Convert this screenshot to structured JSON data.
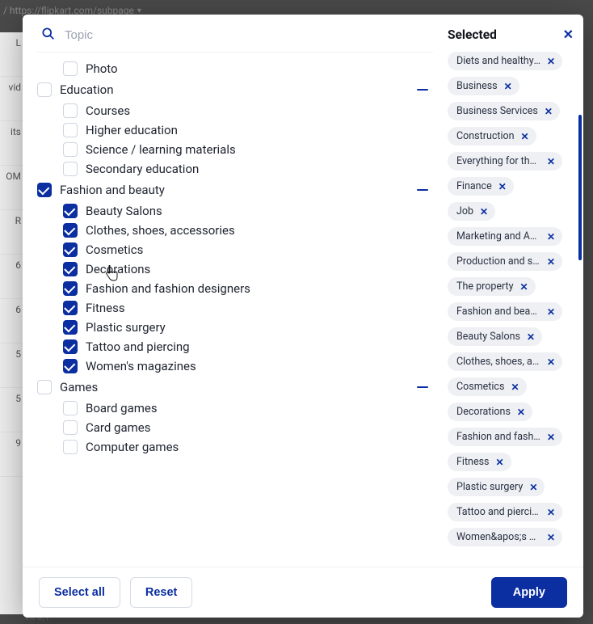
{
  "bg": {
    "url": "/ https://flipkart.com/subpage",
    "left_labels": [
      "L",
      "vid",
      "its",
      "OM",
      "R",
      "6",
      "6",
      "5",
      "5",
      "9"
    ],
    "bottom": "1k   0,1"
  },
  "search": {
    "placeholder": "Topic"
  },
  "tree": [
    {
      "label": "Photo",
      "depth": 1,
      "checked": false
    },
    {
      "label": "Education",
      "depth": 0,
      "checked": false,
      "collapsible": true
    },
    {
      "label": "Courses",
      "depth": 1,
      "checked": false
    },
    {
      "label": "Higher education",
      "depth": 1,
      "checked": false
    },
    {
      "label": "Science / learning materials",
      "depth": 1,
      "checked": false
    },
    {
      "label": "Secondary education",
      "depth": 1,
      "checked": false
    },
    {
      "label": "Fashion and beauty",
      "depth": 0,
      "checked": true,
      "collapsible": true
    },
    {
      "label": "Beauty Salons",
      "depth": 1,
      "checked": true
    },
    {
      "label": "Clothes, shoes, accessories",
      "depth": 1,
      "checked": true
    },
    {
      "label": "Cosmetics",
      "depth": 1,
      "checked": true
    },
    {
      "label": "Decorations",
      "depth": 1,
      "checked": true
    },
    {
      "label": "Fashion and fashion designers",
      "depth": 1,
      "checked": true
    },
    {
      "label": "Fitness",
      "depth": 1,
      "checked": true
    },
    {
      "label": "Plastic surgery",
      "depth": 1,
      "checked": true
    },
    {
      "label": "Tattoo and piercing",
      "depth": 1,
      "checked": true
    },
    {
      "label": "Women's magazines",
      "depth": 1,
      "checked": true
    },
    {
      "label": "Games",
      "depth": 0,
      "checked": false,
      "collapsible": true
    },
    {
      "label": "Board games",
      "depth": 1,
      "checked": false
    },
    {
      "label": "Card games",
      "depth": 1,
      "checked": false
    },
    {
      "label": "Computer games",
      "depth": 1,
      "checked": false
    }
  ],
  "selected": {
    "heading": "Selected",
    "items": [
      "Diets and healthy eating",
      "Business",
      "Business Services",
      "Construction",
      "Everything for the office",
      "Finance",
      "Job",
      "Marketing and Advertising",
      "Production and supplies",
      "The property",
      "Fashion and beauty",
      "Beauty Salons",
      "Clothes, shoes, accessories",
      "Cosmetics",
      "Decorations",
      "Fashion and fashion designers",
      "Fitness",
      "Plastic surgery",
      "Tattoo and piercing",
      "Women&apos;s magazines"
    ]
  },
  "footer": {
    "select_all": "Select all",
    "reset": "Reset",
    "apply": "Apply"
  }
}
